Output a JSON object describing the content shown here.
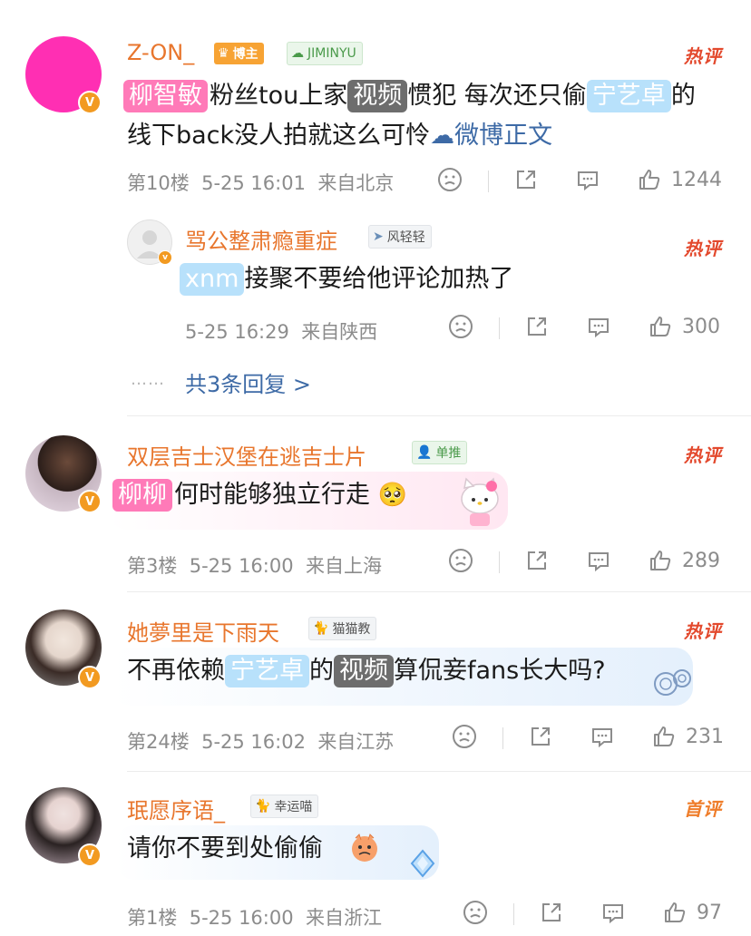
{
  "comments": [
    {
      "username": "Z-ON_",
      "badge1": "博主",
      "badge2": "JIMINYU",
      "hot": "热评",
      "tag1": "柳智敏",
      "text1": "粉丝tou上家",
      "tag2": "视频",
      "text2": "惯犯 每次还只偷",
      "tag3": "宁艺卓",
      "text3": "的",
      "line2": "线下back没人拍就这么可怜",
      "link": "微博正文",
      "floor": "第10楼",
      "time": "5-25 16:01",
      "location": "来自北京",
      "likes": "1244",
      "reply": {
        "username": "骂公整肃瘾重症",
        "badge": "风轻轻",
        "hot": "热评",
        "tag": "xnm",
        "text": "接聚不要给他评论加热了",
        "time": "5-25 16:29",
        "location": "来自陕西",
        "likes": "300"
      },
      "more_dots": "……",
      "more_replies": "共3条回复 >"
    },
    {
      "username": "双层吉士汉堡在逃吉士片",
      "badge": "单推",
      "hot": "热评",
      "tag": "柳柳",
      "text": "何时能够独立行走",
      "emoji": "🥺",
      "floor": "第3楼",
      "time": "5-25 16:00",
      "location": "来自上海",
      "likes": "289"
    },
    {
      "username": "她夢里是下雨天",
      "badge": "猫猫教",
      "hot": "热评",
      "text1": "不再依赖",
      "tag1": "宁艺卓",
      "text2": "的",
      "tag2": "视频",
      "text3": "算侃妾fans长大吗?",
      "floor": "第24楼",
      "time": "5-25 16:02",
      "location": "来自江苏",
      "likes": "231"
    },
    {
      "username": "珉愿序语_",
      "badge": "幸运喵",
      "hot": "首评",
      "text": "请你不要到处偷偷",
      "floor": "第1楼",
      "time": "5-25 16:00",
      "location": "来自浙江",
      "likes": "97"
    }
  ],
  "colors": {
    "username": "#e8762d",
    "hot": "#e3492d",
    "first": "#ef7d2a",
    "link": "#3d6aa6",
    "meta": "#8c8c8c"
  }
}
